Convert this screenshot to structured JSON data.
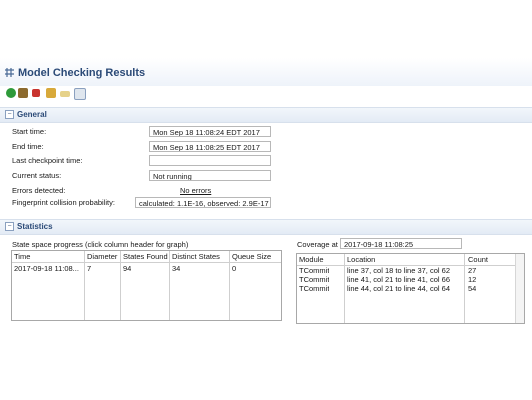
{
  "header": {
    "title": "Model Checking Results"
  },
  "toolbar": {
    "icons": [
      "run-icon",
      "settings-icon",
      "stop-icon",
      "lock-icon",
      "key-icon",
      "copy-icon"
    ]
  },
  "general": {
    "section_title": "General",
    "start_time_label": "Start time:",
    "start_time_value": "Mon Sep 18 11:08:24 EDT 2017",
    "end_time_label": "End time:",
    "end_time_value": "Mon Sep 18 11:08:25 EDT 2017",
    "last_checkpoint_label": "Last checkpoint time:",
    "last_checkpoint_value": "",
    "current_status_label": "Current status:",
    "current_status_value": "Not running",
    "errors_label": "Errors detected:",
    "errors_value": "No errors",
    "fingerprint_label": "Fingerprint collision probability:",
    "fingerprint_value": "calculated: 1.1E-16,  observed: 2.9E-17"
  },
  "statistics": {
    "section_title": "Statistics",
    "state_space_label": "State space progress (click column header for graph)",
    "state_columns": [
      "Time",
      "Diameter",
      "States Found",
      "Distinct States",
      "Queue Size"
    ],
    "state_rows": [
      [
        "2017-09-18 11:08...",
        "7",
        "94",
        "34",
        "0"
      ]
    ],
    "coverage_label": "Coverage at",
    "coverage_value": "2017-09-18 11:08:25",
    "coverage_columns": [
      "Module",
      "Location",
      "Count"
    ],
    "coverage_rows": [
      [
        "TCommit",
        "line 37, col 18 to line 37, col 62",
        "27"
      ],
      [
        "TCommit",
        "line 41, col 21 to line 41, col 66",
        "12"
      ],
      [
        "TCommit",
        "line 44, col 21 to line 44, col 64",
        "54"
      ]
    ]
  }
}
